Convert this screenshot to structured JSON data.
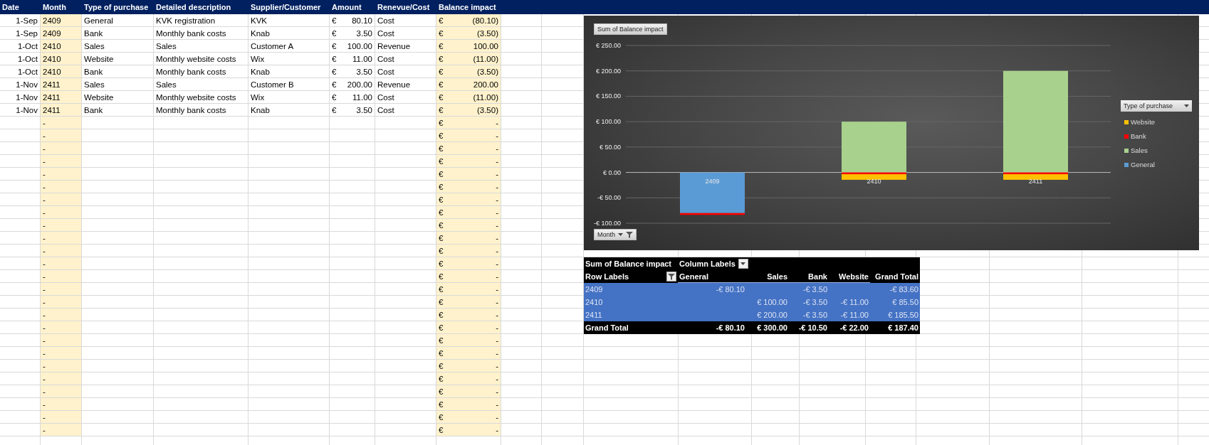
{
  "sheet": {
    "columns": [
      "Date",
      "Month",
      "Type of purchase",
      "Detailed description",
      "Supplier/Customer",
      "Amount",
      "Renevue/Cost",
      "Balance impact"
    ],
    "rows": [
      {
        "date": "1-Sep",
        "month": "2409",
        "type": "General",
        "description": "KVK registration",
        "supplier": "KVK",
        "amount_currency": "€",
        "amount": "80.10",
        "kind": "Cost",
        "balance_currency": "€",
        "balance": "(80.10)"
      },
      {
        "date": "1-Sep",
        "month": "2409",
        "type": "Bank",
        "description": "Monthly bank costs",
        "supplier": "Knab",
        "amount_currency": "€",
        "amount": "3.50",
        "kind": "Cost",
        "balance_currency": "€",
        "balance": "(3.50)"
      },
      {
        "date": "1-Oct",
        "month": "2410",
        "type": "Sales",
        "description": "Sales",
        "supplier": "Customer A",
        "amount_currency": "€",
        "amount": "100.00",
        "kind": "Revenue",
        "balance_currency": "€",
        "balance": "100.00"
      },
      {
        "date": "1-Oct",
        "month": "2410",
        "type": "Website",
        "description": "Monthly website costs",
        "supplier": "Wix",
        "amount_currency": "€",
        "amount": "11.00",
        "kind": "Cost",
        "balance_currency": "€",
        "balance": "(11.00)"
      },
      {
        "date": "1-Oct",
        "month": "2410",
        "type": "Bank",
        "description": "Monthly bank costs",
        "supplier": "Knab",
        "amount_currency": "€",
        "amount": "3.50",
        "kind": "Cost",
        "balance_currency": "€",
        "balance": "(3.50)"
      },
      {
        "date": "1-Nov",
        "month": "2411",
        "type": "Sales",
        "description": "Sales",
        "supplier": "Customer B",
        "amount_currency": "€",
        "amount": "200.00",
        "kind": "Revenue",
        "balance_currency": "€",
        "balance": "200.00"
      },
      {
        "date": "1-Nov",
        "month": "2411",
        "type": "Website",
        "description": "Monthly website costs",
        "supplier": "Wix",
        "amount_currency": "€",
        "amount": "11.00",
        "kind": "Cost",
        "balance_currency": "€",
        "balance": "(11.00)"
      },
      {
        "date": "1-Nov",
        "month": "2411",
        "type": "Bank",
        "description": "Monthly bank costs",
        "supplier": "Knab",
        "amount_currency": "€",
        "amount": "3.50",
        "kind": "Cost",
        "balance_currency": "€",
        "balance": "(3.50)"
      },
      {
        "month": "-",
        "balance_currency": "€",
        "balance": "-"
      },
      {
        "month": "-",
        "balance_currency": "€",
        "balance": "-"
      },
      {
        "month": "-",
        "balance_currency": "€",
        "balance": "-"
      },
      {
        "month": "-",
        "balance_currency": "€",
        "balance": "-"
      },
      {
        "month": "-",
        "balance_currency": "€",
        "balance": "-"
      },
      {
        "month": "-",
        "balance_currency": "€",
        "balance": "-"
      },
      {
        "month": "-",
        "balance_currency": "€",
        "balance": "-"
      },
      {
        "month": "-",
        "balance_currency": "€",
        "balance": "-"
      },
      {
        "month": "-",
        "balance_currency": "€",
        "balance": "-"
      },
      {
        "month": "-",
        "balance_currency": "€",
        "balance": "-"
      },
      {
        "month": "-",
        "balance_currency": "€",
        "balance": "-"
      },
      {
        "month": "-",
        "balance_currency": "€",
        "balance": "-"
      },
      {
        "month": "-",
        "balance_currency": "€",
        "balance": "-"
      },
      {
        "month": "-",
        "balance_currency": "€",
        "balance": "-"
      },
      {
        "month": "-",
        "balance_currency": "€",
        "balance": "-"
      },
      {
        "month": "-",
        "balance_currency": "€",
        "balance": "-"
      },
      {
        "month": "-",
        "balance_currency": "€",
        "balance": "-"
      },
      {
        "month": "-",
        "balance_currency": "€",
        "balance": "-"
      },
      {
        "month": "-",
        "balance_currency": "€",
        "balance": "-"
      },
      {
        "month": "-",
        "balance_currency": "€",
        "balance": "-"
      },
      {
        "month": "-",
        "balance_currency": "€",
        "balance": "-"
      },
      {
        "month": "-",
        "balance_currency": "€",
        "balance": "-"
      },
      {
        "month": "-",
        "balance_currency": "€",
        "balance": "-"
      },
      {
        "month": "-",
        "balance_currency": "€",
        "balance": "-"
      },
      {
        "month": "-",
        "balance_currency": "€",
        "balance": "-"
      }
    ]
  },
  "chart": {
    "title_button": "Sum of Balance impact",
    "axis_button": "Month",
    "legend_button": "Type of purchase",
    "chart_data": {
      "type": "bar",
      "stacked": true,
      "grid": true,
      "legend": "right",
      "categories": [
        "2409",
        "2410",
        "2411"
      ],
      "series": [
        {
          "name": "General",
          "color": "#5b9bd5",
          "values": [
            -80.1,
            null,
            null
          ]
        },
        {
          "name": "Sales",
          "color": "#a9d18e",
          "values": [
            null,
            100,
            200
          ]
        },
        {
          "name": "Bank",
          "color": "#ff0000",
          "values": [
            -3.5,
            -3.5,
            -3.5
          ]
        },
        {
          "name": "Website",
          "color": "#ffc000",
          "values": [
            null,
            -11,
            -11
          ]
        }
      ],
      "ylim": [
        -100,
        250
      ],
      "yticks": [
        {
          "value": -100,
          "label": "-€ 100.00"
        },
        {
          "value": -50,
          "label": "-€ 50.00"
        },
        {
          "value": 0,
          "label": "€ 0.00"
        },
        {
          "value": 50,
          "label": "€ 50.00"
        },
        {
          "value": 100,
          "label": "€ 100.00"
        },
        {
          "value": 150,
          "label": "€ 150.00"
        },
        {
          "value": 200,
          "label": "€ 200.00"
        },
        {
          "value": 250,
          "label": "€ 250.00"
        }
      ]
    }
  },
  "pivot": {
    "title": "Sum of Balance impact",
    "column_labels": "Column Labels",
    "row_labels": "Row Labels",
    "columns": [
      "General",
      "Sales",
      "Bank",
      "Website",
      "Grand Total"
    ],
    "rows": [
      {
        "label": "2409",
        "cells": [
          "-€ 80.10",
          null,
          "-€ 3.50",
          null,
          "-€ 83.60"
        ]
      },
      {
        "label": "2410",
        "cells": [
          null,
          "€ 100.00",
          "-€ 3.50",
          "-€ 11.00",
          "€ 85.50"
        ]
      },
      {
        "label": "2411",
        "cells": [
          null,
          "€ 200.00",
          "-€ 3.50",
          "-€ 11.00",
          "€ 185.50"
        ]
      }
    ],
    "grand_total": {
      "label": "Grand Total",
      "cells": [
        "-€ 80.10",
        "€ 300.00",
        "-€ 10.50",
        "-€ 22.00",
        "€ 187.40"
      ]
    }
  }
}
